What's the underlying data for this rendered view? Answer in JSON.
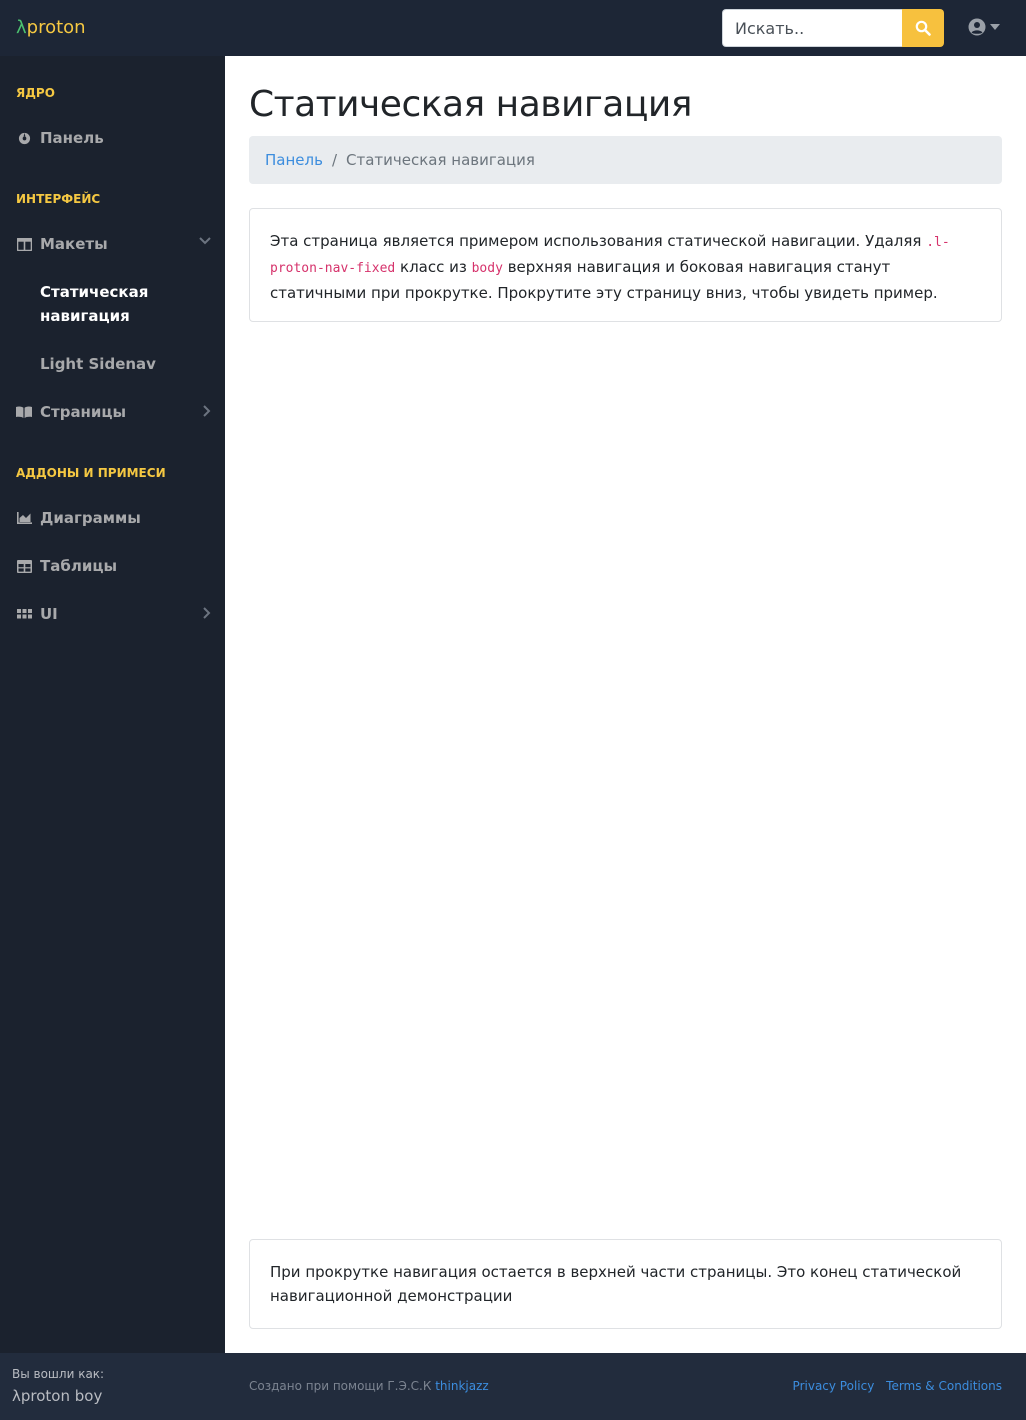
{
  "topnav": {
    "brand_lambda": "λ",
    "brand_name": "proton",
    "search_placeholder": "Искать..",
    "colors": {
      "bg": "#1d2636",
      "brand": "#f5c842",
      "lambda": "#4cc270",
      "search_button": "#f7c13e"
    }
  },
  "sidebar": {
    "sections": [
      {
        "heading": "ЯДРО",
        "items": [
          {
            "label": "Панель",
            "icon": "gauge-icon"
          }
        ]
      },
      {
        "heading": "ИНТЕРФЕЙС",
        "items": [
          {
            "label": "Макеты",
            "icon": "columns-icon",
            "expanded": true,
            "subitems": [
              {
                "label": "Статическая навигация",
                "active": true
              },
              {
                "label": "Light Sidenav",
                "active": false
              }
            ]
          },
          {
            "label": "Страницы",
            "icon": "book-open-icon",
            "expanded": false
          }
        ]
      },
      {
        "heading": "АДДОНЫ И ПРИМЕСИ",
        "items": [
          {
            "label": "Диаграммы",
            "icon": "area-chart-icon"
          },
          {
            "label": "Таблицы",
            "icon": "table-icon"
          },
          {
            "label": "UI",
            "icon": "grid-icon",
            "expanded": false
          }
        ]
      }
    ],
    "footer": {
      "label": "Вы вошли как:",
      "user": "λproton boy"
    }
  },
  "main": {
    "title": "Статическая навигация",
    "breadcrumb": {
      "link": "Панель",
      "separator": "/",
      "current": "Статическая навигация"
    },
    "card1": {
      "text_a": "Эта страница является примером использования статической навигации. Удаляя ",
      "code_a": ".l-proton-nav-fixed",
      "text_b": " класс из ",
      "code_b": "body",
      "text_c": " верхняя навигация и боковая навигация станут статичными при прокрутке. Прокрутите эту страницу вниз, чтобы увидеть пример."
    },
    "card2": {
      "text": "При прокрутке навигация остается в верхней части страницы. Это конец статической навигационной демонстрации"
    }
  },
  "footer": {
    "made_by": "Создано при помощи Г.Э.С.К",
    "made_by_link": "thinkjazz",
    "privacy": "Privacy Policy",
    "terms": "Terms & Conditions"
  }
}
